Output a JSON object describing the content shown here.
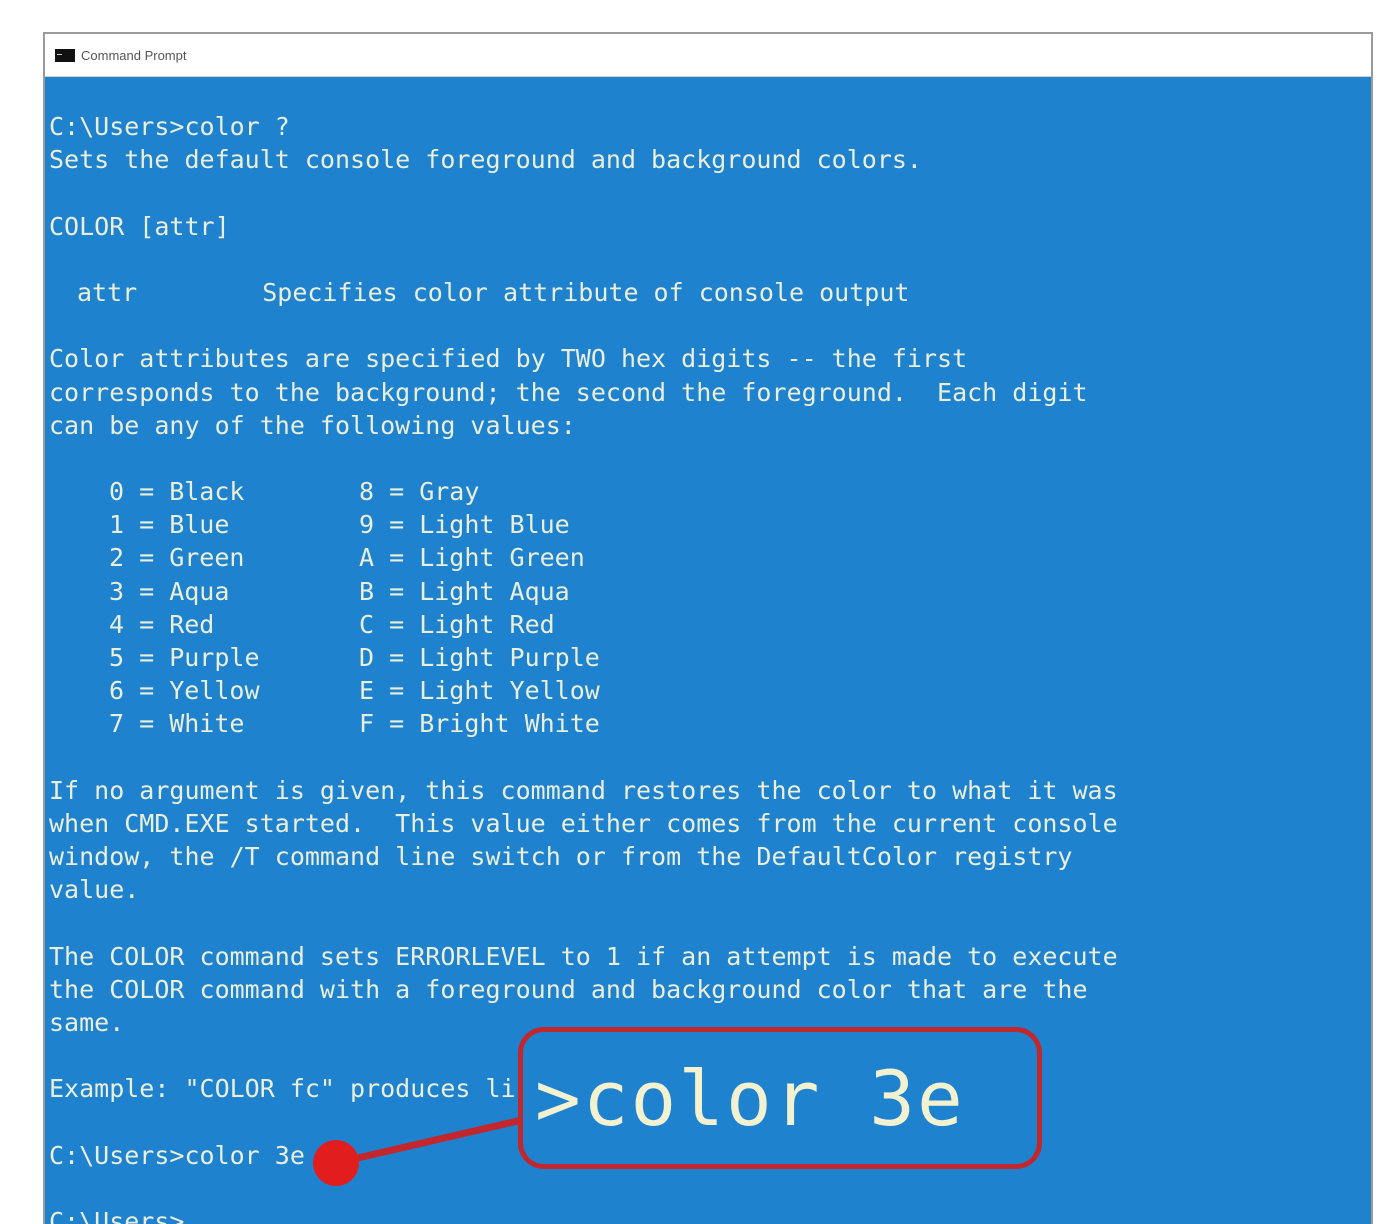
{
  "window": {
    "title": "Command Prompt"
  },
  "console": {
    "line1": "C:\\Users>color ?",
    "line2": "Sets the default console foreground and background colors.",
    "syntax": "COLOR [attr]",
    "attr_name": "attr",
    "attr_desc": "Specifies color attribute of console output",
    "para1": [
      "Color attributes are specified by TWO hex digits -- the first",
      "corresponds to the background; the second the foreground.  Each digit",
      "can be any of the following values:"
    ],
    "colors_left": [
      "0 = Black",
      "1 = Blue",
      "2 = Green",
      "3 = Aqua",
      "4 = Red",
      "5 = Purple",
      "6 = Yellow",
      "7 = White"
    ],
    "colors_right": [
      "8 = Gray",
      "9 = Light Blue",
      "A = Light Green",
      "B = Light Aqua",
      "C = Light Red",
      "D = Light Purple",
      "E = Light Yellow",
      "F = Bright White"
    ],
    "para2": [
      "If no argument is given, this command restores the color to what it was",
      "when CMD.EXE started.  This value either comes from the current console",
      "window, the /T command line switch or from the DefaultColor registry",
      "value."
    ],
    "para3": [
      "The COLOR command sets ERRORLEVEL to 1 if an attempt is made to execute",
      "the COLOR command with a foreground and background color that are the",
      "same."
    ],
    "example": "Example: \"COLOR fc\" produces li",
    "command": "C:\\Users>color 3e",
    "prompt": "C:\\Users>"
  },
  "callout": {
    "text": ">color 3e",
    "border_color": "#c1272d"
  },
  "colors": {
    "console_bg": "#1f82cf",
    "console_fg": "#e9efd8",
    "annotation": "#c1272d"
  }
}
